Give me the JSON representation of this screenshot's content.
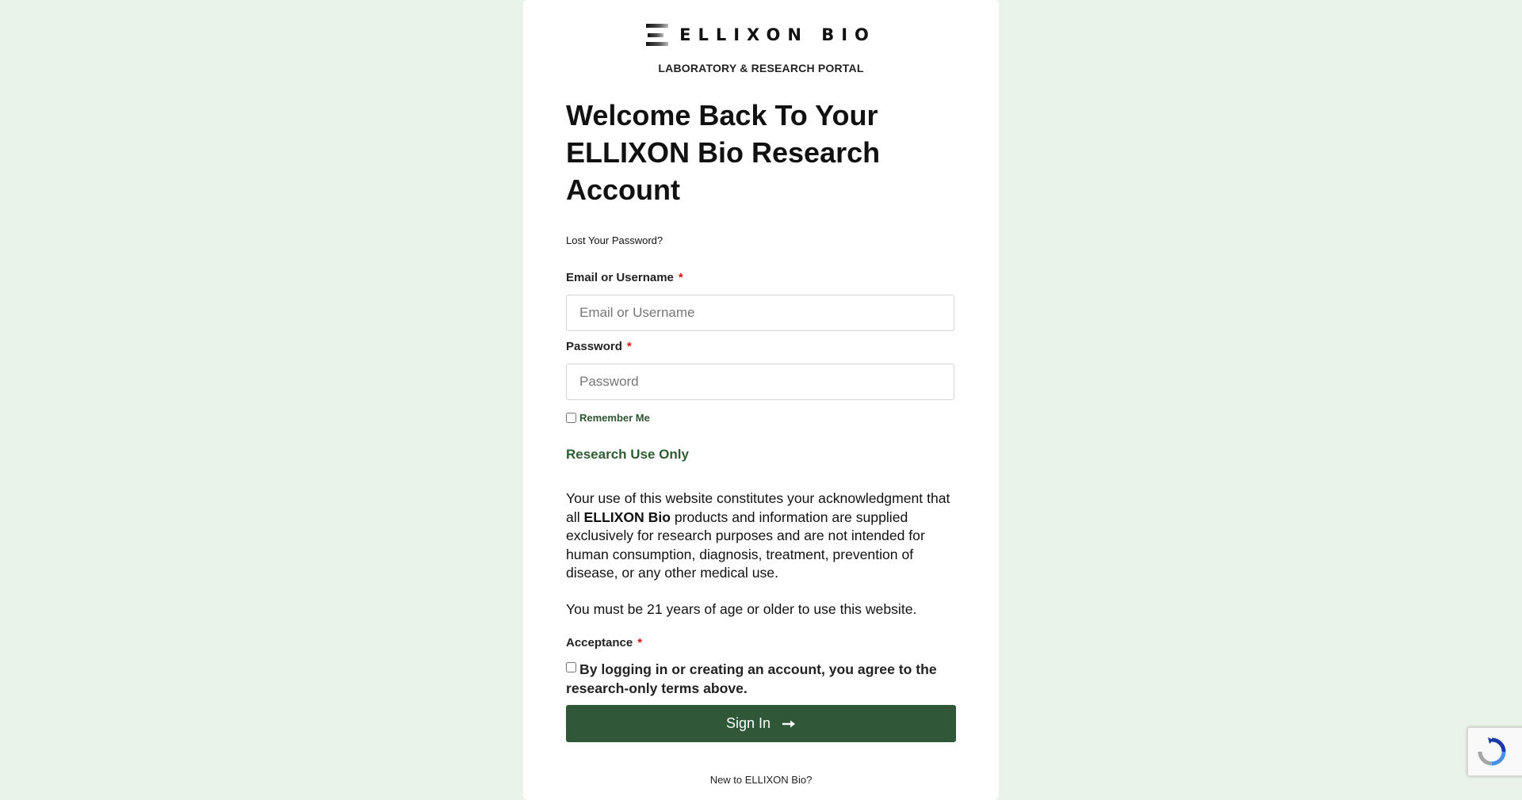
{
  "brand": {
    "logo_text": "ELLIXON BIO",
    "subtitle": "LABORATORY & RESEARCH PORTAL"
  },
  "heading": "Welcome Back To Your ELLIXON Bio Research Account",
  "lost_password_link": "Lost Your Password?",
  "fields": {
    "username": {
      "label": "Email or Username",
      "required_marker": "*",
      "placeholder": "Email or Username",
      "value": ""
    },
    "password": {
      "label": "Password",
      "required_marker": "*",
      "placeholder": "Password",
      "value": ""
    }
  },
  "remember_me": {
    "label": "Remember Me",
    "checked": false
  },
  "research_notice": {
    "title": "Research Use Only",
    "para1_before": "Your use of this website constitutes your acknowledgment that all ",
    "para1_bold": "ELLIXON Bio",
    "para1_after": " products and information are supplied exclusively for research purposes and are not intended for human consumption, diagnosis, treatment, prevention of disease, or any other medical use.",
    "para2": "You must be 21 years of age or older to use this website."
  },
  "acceptance": {
    "label": "Acceptance",
    "required_marker": "*",
    "checkbox_text": "By logging in or creating an account, you agree to the research-only terms above.",
    "checked": false
  },
  "sign_in_button": {
    "label": "Sign In",
    "icon": "arrow-right-icon"
  },
  "footer": {
    "new_to": "New to ELLIXON Bio?"
  },
  "recaptcha": {
    "icon": "recaptcha-icon"
  },
  "colors": {
    "page_background": "#eaf3ea",
    "card_background": "#ffffff",
    "accent_green": "#2f5738",
    "required_red": "#dd1111"
  }
}
